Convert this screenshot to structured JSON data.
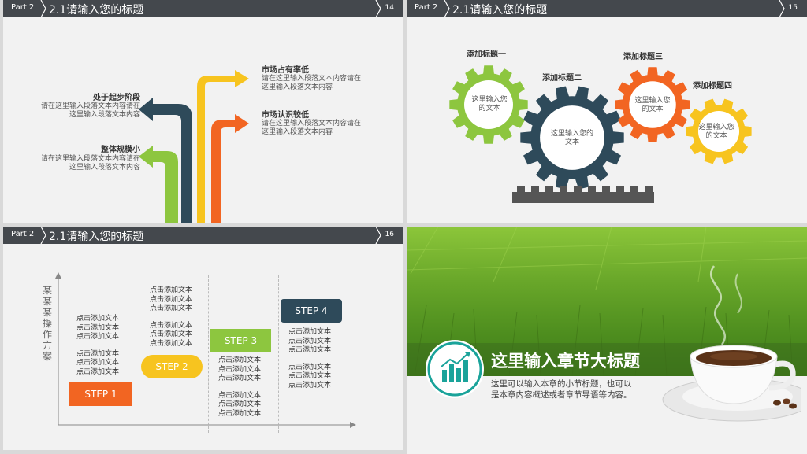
{
  "slides": [
    {
      "part": "Part 2",
      "title": "2.1请输入您的标题",
      "page": "14",
      "items": [
        {
          "heading": "市场占有率低",
          "text1": "请在这里输入段落文本内容请在",
          "text2": "这里输入段落文本内容"
        },
        {
          "heading": "处于起步阶段",
          "text1": "请在这里输入段落文本内容请在",
          "text2": "这里输入段落文本内容"
        },
        {
          "heading": "市场认识较低",
          "text1": "请在这里输入段落文本内容请在",
          "text2": "这里输入段落文本内容"
        },
        {
          "heading": "整体规模小",
          "text1": "请在这里输入段落文本内容请在",
          "text2": "这里输入段落文本内容"
        }
      ]
    },
    {
      "part": "Part 2",
      "title": "2.1请输入您的标题",
      "page": "15",
      "gears": [
        {
          "title": "添加标题一",
          "text1": "这里输入您",
          "text2": "的文本",
          "color": "#8dc63f"
        },
        {
          "title": "添加标题二",
          "text1": "这里输入您的",
          "text2": "文本",
          "color": "#2e4a5a"
        },
        {
          "title": "添加标题三",
          "text1": "这里输入您",
          "text2": "的文本",
          "color": "#f26522"
        },
        {
          "title": "添加标题四",
          "text1": "这里输入您",
          "text2": "的文本",
          "color": "#f7c41f"
        }
      ]
    },
    {
      "part": "Part 2",
      "title": "2.1请输入您的标题",
      "page": "16",
      "axis_label": "某某某操作方案",
      "steps": [
        {
          "label": "STEP 1",
          "color": "#f26522"
        },
        {
          "label": "STEP 2",
          "color": "#f7c41f"
        },
        {
          "label": "STEP 3",
          "color": "#8dc63f"
        },
        {
          "label": "STEP 4",
          "color": "#2e4a5a"
        }
      ],
      "line": "点击添加文本"
    },
    {
      "title": "这里输入章节大标题",
      "sub1": "这里可以输入本章的小节标题，也可以",
      "sub2": "是本章内容概述或者章节导语等内容。"
    }
  ]
}
